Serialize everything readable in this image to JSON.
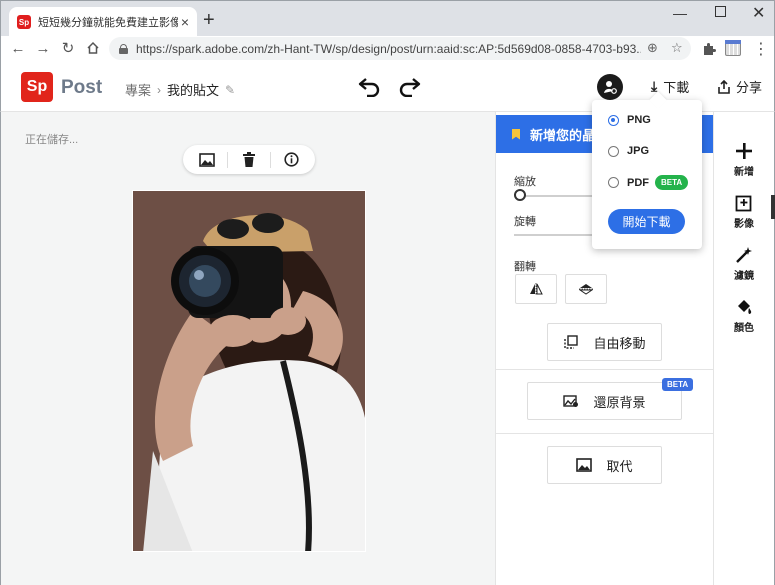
{
  "browser": {
    "tab_title": "短短幾分鐘就能免費建立影像 · Ad",
    "favicon_text": "Sp",
    "url": "https://spark.adobe.com/zh-Hant-TW/sp/design/post/urn:aaid:sc:AP:5d569d08-0858-4703-b93..."
  },
  "app": {
    "logo_text": "Sp",
    "name": "Post",
    "breadcrumb_projects": "專案",
    "breadcrumb_separator": "›",
    "breadcrumb_current": "我的貼文",
    "download_label": "下載",
    "share_label": "分享"
  },
  "canvas": {
    "status": "正在儲存..."
  },
  "panel": {
    "header": "新增您的晶",
    "zoom_label": "縮放",
    "rotate_label": "旋轉",
    "flip_label": "翻轉",
    "free_move_label": "自由移動",
    "restore_bg_label": "還原背景",
    "restore_bg_badge": "BETA",
    "replace_label": "取代"
  },
  "rail": {
    "add_label": "新增",
    "image_label": "影像",
    "filter_label": "濾鏡",
    "color_label": "顏色"
  },
  "download_menu": {
    "options": [
      {
        "label": "PNG",
        "selected": true
      },
      {
        "label": "JPG",
        "selected": false
      },
      {
        "label": "PDF",
        "selected": false,
        "badge": "BETA"
      }
    ],
    "start_label": "開始下載"
  },
  "colors": {
    "accent_blue": "#2d6fe6",
    "brand_red": "#e1251b",
    "beta_green": "#24b34b",
    "photo_bg": "#6d4f45"
  }
}
